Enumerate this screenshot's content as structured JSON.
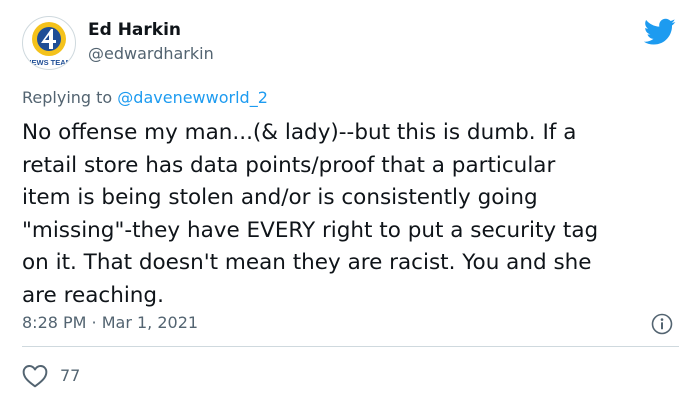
{
  "author": {
    "display_name": "Ed Harkin",
    "handle": "@edwardharkin",
    "avatar_text": "NEWS TEAM"
  },
  "reply": {
    "prefix": "Replying to ",
    "mention": "@davenewworld_2"
  },
  "tweet": {
    "text": "No offense my man...(& lady)--but this is dumb. If a\nretail store has data points/proof that a particular\nitem is being stolen and/or is consistently going\n\"missing\"-they have EVERY right to put a security tag\non it.  That doesn't mean they are racist.  You and she\nare reaching.",
    "timestamp": "8:28 PM · Mar 1, 2021"
  },
  "engagement": {
    "likes": "77"
  },
  "colors": {
    "twitter_blue": "#1d9bf0",
    "secondary_text": "#536471",
    "divider": "#cfd9de",
    "logo_blue": "#1f4e96",
    "logo_yellow": "#f4c21b"
  },
  "icons": [
    "channel-4-logo",
    "twitter-bird-icon",
    "info-icon",
    "heart-icon"
  ]
}
